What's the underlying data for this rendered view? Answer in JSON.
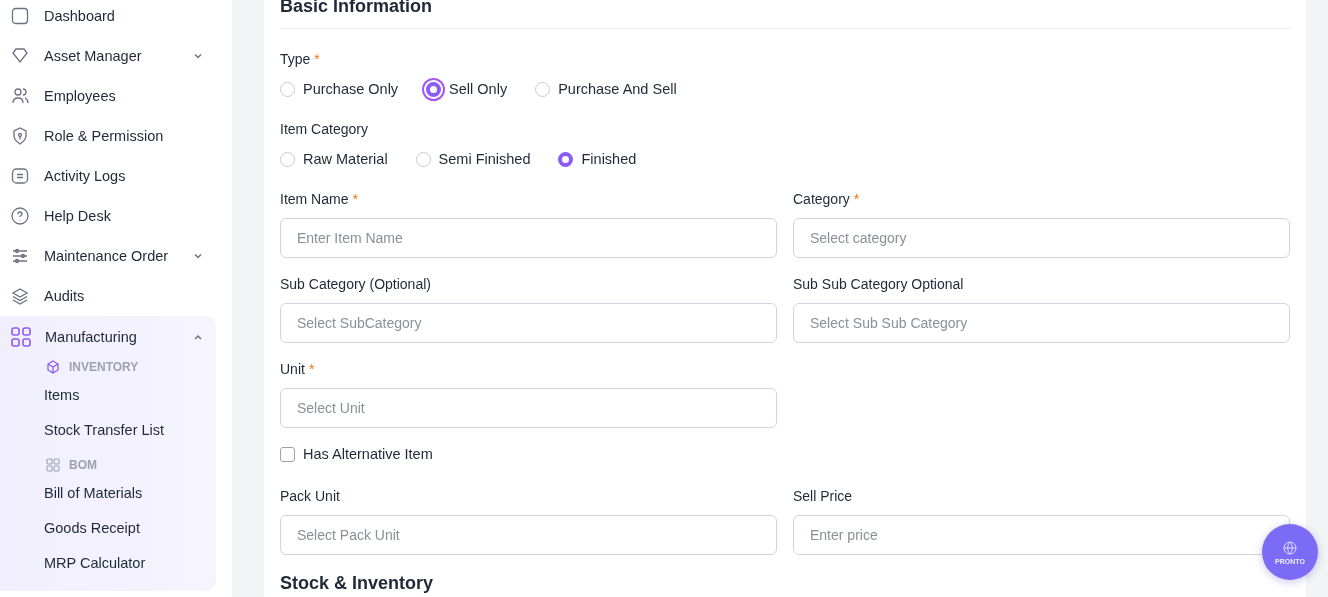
{
  "sidebar": {
    "items": [
      {
        "label": "Dashboard"
      },
      {
        "label": "Asset Manager",
        "expanded": false
      },
      {
        "label": "Employees"
      },
      {
        "label": "Role & Permission"
      },
      {
        "label": "Activity Logs"
      },
      {
        "label": "Help Desk"
      },
      {
        "label": "Maintenance Order",
        "expanded": false
      },
      {
        "label": "Audits"
      },
      {
        "label": "Manufacturing",
        "expanded": true,
        "sections": [
          {
            "heading": "INVENTORY",
            "items": [
              "Items",
              "Stock Transfer List"
            ]
          },
          {
            "heading": "BOM",
            "items": [
              "Bill of Materials",
              "Goods Receipt",
              "MRP Calculator"
            ]
          }
        ]
      }
    ]
  },
  "form": {
    "title": "Basic Information",
    "radio_groups": [
      {
        "label": "Type",
        "mark": "*",
        "options": [
          {
            "label": "Purchase Only",
            "selected": false,
            "focused": false
          },
          {
            "label": "Sell Only",
            "selected": true,
            "focused": true
          },
          {
            "label": "Purchase And Sell",
            "selected": false,
            "focused": false
          }
        ]
      },
      {
        "label": "Item Category",
        "options": [
          {
            "label": "Raw Material",
            "selected": false
          },
          {
            "label": "Semi Finished",
            "selected": false
          },
          {
            "label": "Finished",
            "selected": true
          }
        ]
      }
    ],
    "field_rows": [
      {
        "fields": [
          {
            "label": "Item Name",
            "mark": "*",
            "placeholder": "Enter Item Name"
          },
          {
            "label": "Category",
            "mark": "*",
            "placeholder": "Select category"
          }
        ]
      },
      {
        "fields": [
          {
            "label": "Sub Category (Optional)",
            "placeholder": "Select SubCategory"
          },
          {
            "label": "Sub Sub Category Optional",
            "placeholder": "Select Sub Sub Category"
          }
        ]
      },
      {
        "fields": [
          {
            "label": "Unit",
            "mark": "*",
            "placeholder": "Select Unit"
          }
        ]
      }
    ],
    "checkbox": {
      "label": "Has Alternative Item",
      "checked": false
    },
    "field_rows_2": [
      {
        "fields": [
          {
            "label": "Pack Unit",
            "placeholder": "Select Pack Unit"
          },
          {
            "label": "Sell Price",
            "placeholder": "Enter price"
          }
        ]
      }
    ],
    "next_section_title": "Stock & Inventory"
  },
  "assistant_button": {
    "label": "PRONTO"
  }
}
